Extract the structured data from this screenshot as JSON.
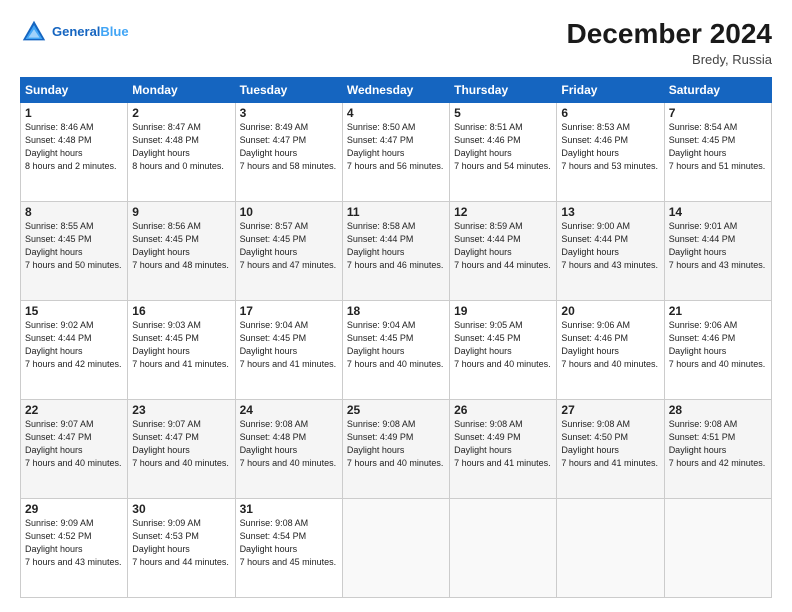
{
  "header": {
    "logo_line1": "General",
    "logo_line2": "Blue",
    "month_title": "December 2024",
    "location": "Bredy, Russia"
  },
  "days_of_week": [
    "Sunday",
    "Monday",
    "Tuesday",
    "Wednesday",
    "Thursday",
    "Friday",
    "Saturday"
  ],
  "weeks": [
    [
      {
        "day": "1",
        "sunrise": "8:46 AM",
        "sunset": "4:48 PM",
        "daylight": "8 hours and 2 minutes."
      },
      {
        "day": "2",
        "sunrise": "8:47 AM",
        "sunset": "4:48 PM",
        "daylight": "8 hours and 0 minutes."
      },
      {
        "day": "3",
        "sunrise": "8:49 AM",
        "sunset": "4:47 PM",
        "daylight": "7 hours and 58 minutes."
      },
      {
        "day": "4",
        "sunrise": "8:50 AM",
        "sunset": "4:47 PM",
        "daylight": "7 hours and 56 minutes."
      },
      {
        "day": "5",
        "sunrise": "8:51 AM",
        "sunset": "4:46 PM",
        "daylight": "7 hours and 54 minutes."
      },
      {
        "day": "6",
        "sunrise": "8:53 AM",
        "sunset": "4:46 PM",
        "daylight": "7 hours and 53 minutes."
      },
      {
        "day": "7",
        "sunrise": "8:54 AM",
        "sunset": "4:45 PM",
        "daylight": "7 hours and 51 minutes."
      }
    ],
    [
      {
        "day": "8",
        "sunrise": "8:55 AM",
        "sunset": "4:45 PM",
        "daylight": "7 hours and 50 minutes."
      },
      {
        "day": "9",
        "sunrise": "8:56 AM",
        "sunset": "4:45 PM",
        "daylight": "7 hours and 48 minutes."
      },
      {
        "day": "10",
        "sunrise": "8:57 AM",
        "sunset": "4:45 PM",
        "daylight": "7 hours and 47 minutes."
      },
      {
        "day": "11",
        "sunrise": "8:58 AM",
        "sunset": "4:44 PM",
        "daylight": "7 hours and 46 minutes."
      },
      {
        "day": "12",
        "sunrise": "8:59 AM",
        "sunset": "4:44 PM",
        "daylight": "7 hours and 44 minutes."
      },
      {
        "day": "13",
        "sunrise": "9:00 AM",
        "sunset": "4:44 PM",
        "daylight": "7 hours and 43 minutes."
      },
      {
        "day": "14",
        "sunrise": "9:01 AM",
        "sunset": "4:44 PM",
        "daylight": "7 hours and 43 minutes."
      }
    ],
    [
      {
        "day": "15",
        "sunrise": "9:02 AM",
        "sunset": "4:44 PM",
        "daylight": "7 hours and 42 minutes."
      },
      {
        "day": "16",
        "sunrise": "9:03 AM",
        "sunset": "4:45 PM",
        "daylight": "7 hours and 41 minutes."
      },
      {
        "day": "17",
        "sunrise": "9:04 AM",
        "sunset": "4:45 PM",
        "daylight": "7 hours and 41 minutes."
      },
      {
        "day": "18",
        "sunrise": "9:04 AM",
        "sunset": "4:45 PM",
        "daylight": "7 hours and 40 minutes."
      },
      {
        "day": "19",
        "sunrise": "9:05 AM",
        "sunset": "4:45 PM",
        "daylight": "7 hours and 40 minutes."
      },
      {
        "day": "20",
        "sunrise": "9:06 AM",
        "sunset": "4:46 PM",
        "daylight": "7 hours and 40 minutes."
      },
      {
        "day": "21",
        "sunrise": "9:06 AM",
        "sunset": "4:46 PM",
        "daylight": "7 hours and 40 minutes."
      }
    ],
    [
      {
        "day": "22",
        "sunrise": "9:07 AM",
        "sunset": "4:47 PM",
        "daylight": "7 hours and 40 minutes."
      },
      {
        "day": "23",
        "sunrise": "9:07 AM",
        "sunset": "4:47 PM",
        "daylight": "7 hours and 40 minutes."
      },
      {
        "day": "24",
        "sunrise": "9:08 AM",
        "sunset": "4:48 PM",
        "daylight": "7 hours and 40 minutes."
      },
      {
        "day": "25",
        "sunrise": "9:08 AM",
        "sunset": "4:49 PM",
        "daylight": "7 hours and 40 minutes."
      },
      {
        "day": "26",
        "sunrise": "9:08 AM",
        "sunset": "4:49 PM",
        "daylight": "7 hours and 41 minutes."
      },
      {
        "day": "27",
        "sunrise": "9:08 AM",
        "sunset": "4:50 PM",
        "daylight": "7 hours and 41 minutes."
      },
      {
        "day": "28",
        "sunrise": "9:08 AM",
        "sunset": "4:51 PM",
        "daylight": "7 hours and 42 minutes."
      }
    ],
    [
      {
        "day": "29",
        "sunrise": "9:09 AM",
        "sunset": "4:52 PM",
        "daylight": "7 hours and 43 minutes."
      },
      {
        "day": "30",
        "sunrise": "9:09 AM",
        "sunset": "4:53 PM",
        "daylight": "7 hours and 44 minutes."
      },
      {
        "day": "31",
        "sunrise": "9:08 AM",
        "sunset": "4:54 PM",
        "daylight": "7 hours and 45 minutes."
      },
      null,
      null,
      null,
      null
    ]
  ],
  "labels": {
    "sunrise": "Sunrise:",
    "sunset": "Sunset:",
    "daylight": "Daylight hours"
  }
}
